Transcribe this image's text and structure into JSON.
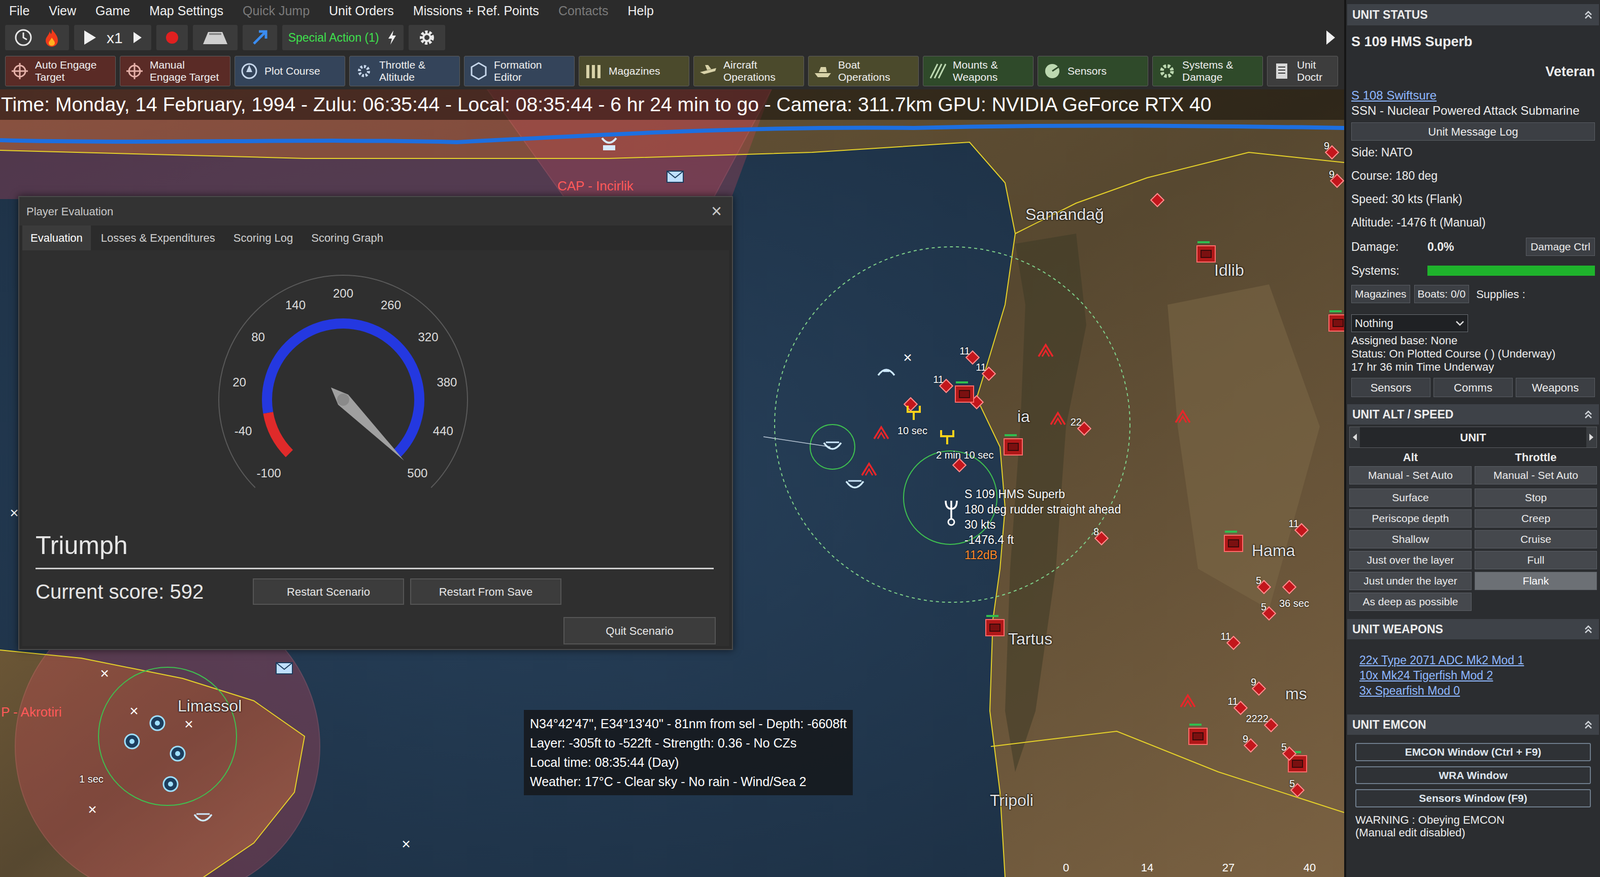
{
  "menu": [
    {
      "label": "File",
      "disabled": false
    },
    {
      "label": "View",
      "disabled": false
    },
    {
      "label": "Game",
      "disabled": false
    },
    {
      "label": "Map Settings",
      "disabled": false
    },
    {
      "label": "Quick Jump",
      "disabled": true
    },
    {
      "label": "Unit Orders",
      "disabled": false
    },
    {
      "label": "Missions + Ref. Points",
      "disabled": false
    },
    {
      "label": "Contacts",
      "disabled": true
    },
    {
      "label": "Help",
      "disabled": false
    }
  ],
  "toolbar": {
    "speed": "x1",
    "special_action": "Special Action (1)"
  },
  "action_buttons": [
    {
      "lines": [
        "Auto Engage",
        "Target"
      ],
      "color": "#5a2b26"
    },
    {
      "lines": [
        "Manual",
        "Engage Target"
      ],
      "color": "#5a2b26"
    },
    {
      "lines": [
        "Plot Course"
      ],
      "color": "#34445a"
    },
    {
      "lines": [
        "Throttle &",
        "Altitude"
      ],
      "color": "#34445a"
    },
    {
      "lines": [
        "Formation",
        "Editor"
      ],
      "color": "#34445a"
    },
    {
      "lines": [
        "Magazines"
      ],
      "color": "#4b4a2c"
    },
    {
      "lines": [
        "Aircraft",
        "Operations"
      ],
      "color": "#4b4a2c"
    },
    {
      "lines": [
        "Boat",
        "Operations"
      ],
      "color": "#4b4a2c"
    },
    {
      "lines": [
        "Mounts &",
        "Weapons"
      ],
      "color": "#2f4a2a"
    },
    {
      "lines": [
        "Sensors"
      ],
      "color": "#2f4a2a"
    },
    {
      "lines": [
        "Systems &",
        "Damage"
      ],
      "color": "#2f4a2a"
    },
    {
      "lines": [
        "Unit",
        "Doctr"
      ],
      "color": "#3d3d3d"
    }
  ],
  "time_bar": "Time: Monday, 14 February, 1994 - Zulu: 06:35:44 - Local: 08:35:44 - 6 hr 24 min to go - Camera: 311.7km GPU: NVIDIA GeForce RTX 40",
  "dialog": {
    "title": "Player Evaluation",
    "close": "×",
    "tabs": [
      {
        "label": "Evaluation",
        "selected": true
      },
      {
        "label": "Losses & Expenditures",
        "selected": false
      },
      {
        "label": "Scoring Log",
        "selected": false
      },
      {
        "label": "Scoring Graph",
        "selected": false
      }
    ],
    "gauge": {
      "ticks": [
        "-100",
        "-40",
        "20",
        "80",
        "140",
        "200",
        "260",
        "320",
        "380",
        "440",
        "500"
      ],
      "red_zone": 0.13,
      "level": 1
    },
    "rating": "Triumph",
    "score": "Current score: 592",
    "buttons": [
      "Restart Scenario",
      "Restart From Save",
      "Quit Scenario"
    ]
  },
  "tooltip": {
    "lines": [
      "N34°42'47\", E34°13'40\" - 81nm from sel - Depth: -6608ft",
      "Layer: -305ft to -522ft - Strength: 0.36 - No CZs",
      "Local time: 08:35:44 (Day)",
      "Weather: 17°C - Clear sky - No rain - Wind/Sea 2"
    ]
  },
  "map": {
    "places": [
      {
        "name": "Samandağ"
      },
      {
        "name": "Idlib"
      },
      {
        "name": "Hama"
      },
      {
        "name": "Tartus"
      },
      {
        "name": "Tripoli"
      },
      {
        "name": "Limassol"
      },
      {
        "name": "ia"
      },
      {
        "name": "ms"
      }
    ],
    "zones": [
      {
        "name": "CAP - Incirlik"
      },
      {
        "name": "P - Akrotiri"
      }
    ],
    "timers": [
      "10 sec",
      "2 min 10 sec",
      "36 sec",
      "1 sec"
    ],
    "unit_label": {
      "name": "S 109 HMS Superb",
      "course": "180 deg  rudder straight ahead",
      "speed": "30 kts",
      "depth": "-1476.4 ft",
      "noise": "112dB"
    },
    "scale": [
      "0",
      "14",
      "27",
      "40"
    ],
    "markers": [
      {
        "kind": "hostile",
        "label": "9"
      },
      {
        "kind": "hostile",
        "label": "9"
      },
      {
        "kind": "hostile"
      },
      {
        "kind": "facility"
      },
      {
        "kind": "facility"
      },
      {
        "kind": "hostile",
        "label": "11"
      },
      {
        "kind": "hostile",
        "label": "11"
      },
      {
        "kind": "hostile",
        "label": "11"
      },
      {
        "kind": "hostile"
      },
      {
        "kind": "facility"
      },
      {
        "kind": "facility"
      },
      {
        "kind": "hostile",
        "label": "22"
      },
      {
        "kind": "hostile",
        "label": "8"
      },
      {
        "kind": "hostile",
        "label": "11"
      },
      {
        "kind": "facility"
      },
      {
        "kind": "hostile",
        "label": "5"
      },
      {
        "kind": "hostile"
      },
      {
        "kind": "hostile",
        "label": "5"
      },
      {
        "kind": "hostile",
        "label": "11"
      },
      {
        "kind": "facility"
      },
      {
        "kind": "hostile",
        "label": "9"
      },
      {
        "kind": "hostile",
        "label": "11"
      },
      {
        "kind": "hostile",
        "label": "2222"
      },
      {
        "kind": "hostile",
        "label": "9"
      },
      {
        "kind": "facility"
      },
      {
        "kind": "facility"
      },
      {
        "kind": "hostile",
        "label": "5"
      },
      {
        "kind": "hostile",
        "label": "5"
      },
      {
        "kind": "hostile"
      },
      {
        "kind": "hostile"
      },
      {
        "kind": "air"
      },
      {
        "kind": "air"
      },
      {
        "kind": "air"
      },
      {
        "kind": "air"
      },
      {
        "kind": "air"
      },
      {
        "kind": "air"
      },
      {
        "kind": "friendly-ship"
      },
      {
        "kind": "friendly-ship"
      },
      {
        "kind": "friendly-air"
      },
      {
        "kind": "yellow-air"
      },
      {
        "kind": "yellow-air"
      },
      {
        "kind": "own-sub"
      },
      {
        "kind": "sam"
      },
      {
        "kind": "mail"
      },
      {
        "kind": "mail"
      },
      {
        "kind": "friendly-base"
      },
      {
        "kind": "friendly-base"
      },
      {
        "kind": "friendly-base"
      },
      {
        "kind": "friendly-base"
      },
      {
        "kind": "friendly-ship"
      },
      {
        "kind": "x",
        "label": "×"
      },
      {
        "kind": "x",
        "label": "×"
      },
      {
        "kind": "x",
        "label": "×"
      },
      {
        "kind": "x",
        "label": "×"
      },
      {
        "kind": "x",
        "label": "×"
      },
      {
        "kind": "x",
        "label": "×"
      },
      {
        "kind": "x",
        "label": "×"
      }
    ]
  },
  "unit_status": {
    "header": "UNIT STATUS",
    "name": "S 109 HMS Superb",
    "rank": "Veteran",
    "group_link": "S 108 Swiftsure",
    "type": "SSN - Nuclear Powered Attack Submarine",
    "message_log": "Unit Message Log",
    "side": "Side: NATO",
    "course": "Course: 180 deg",
    "speed": "Speed: 30 kts (Flank)",
    "altitude": "Altitude: -1476 ft (Manual)",
    "damage_label": "Damage:",
    "damage": "0.0%",
    "damage_ctrl": "Damage Ctrl",
    "systems_label": "Systems:",
    "systems_level": 1,
    "magazines": "Magazines",
    "boats": "Boats: 0/0",
    "supplies": "Supplies :",
    "dropdown": "Nothing",
    "assigned_base": "Assigned base: None",
    "status": "Status: On Plotted Course ( ) (Underway)",
    "time_underway": "17 hr 36 min Time Underway",
    "buttons": [
      "Sensors",
      "Comms",
      "Weapons"
    ]
  },
  "alt_speed": {
    "header": "UNIT ALT / SPEED",
    "selector": "UNIT",
    "alt_label": "Alt",
    "throttle_label": "Throttle",
    "alt_mode": "Manual - Set Auto",
    "throttle_mode": "Manual - Set Auto",
    "alt_presets": [
      {
        "label": "Surface",
        "selected": false
      },
      {
        "label": "Periscope depth",
        "selected": false
      },
      {
        "label": "Shallow",
        "selected": false
      },
      {
        "label": "Just over the layer",
        "selected": false
      },
      {
        "label": "Just under the layer",
        "selected": false
      },
      {
        "label": "As deep as possible",
        "selected": false
      }
    ],
    "throttle_presets": [
      {
        "label": "Stop",
        "selected": false
      },
      {
        "label": "Creep",
        "selected": false
      },
      {
        "label": "Cruise",
        "selected": false
      },
      {
        "label": "Full",
        "selected": false
      },
      {
        "label": "Flank",
        "selected": true
      }
    ]
  },
  "weapons": {
    "header": "UNIT WEAPONS",
    "items": [
      "22x Type 2071 ADC Mk2 Mod 1",
      "10x Mk24 Tigerfish Mod 2",
      "3x Spearfish Mod 0"
    ]
  },
  "emcon": {
    "header": "UNIT EMCON",
    "buttons": [
      "EMCON Window (Ctrl + F9)",
      "WRA Window",
      "Sensors Window (F9)"
    ],
    "warning": [
      "WARNING : Obeying EMCON",
      "(Manual edit disabled)"
    ]
  }
}
